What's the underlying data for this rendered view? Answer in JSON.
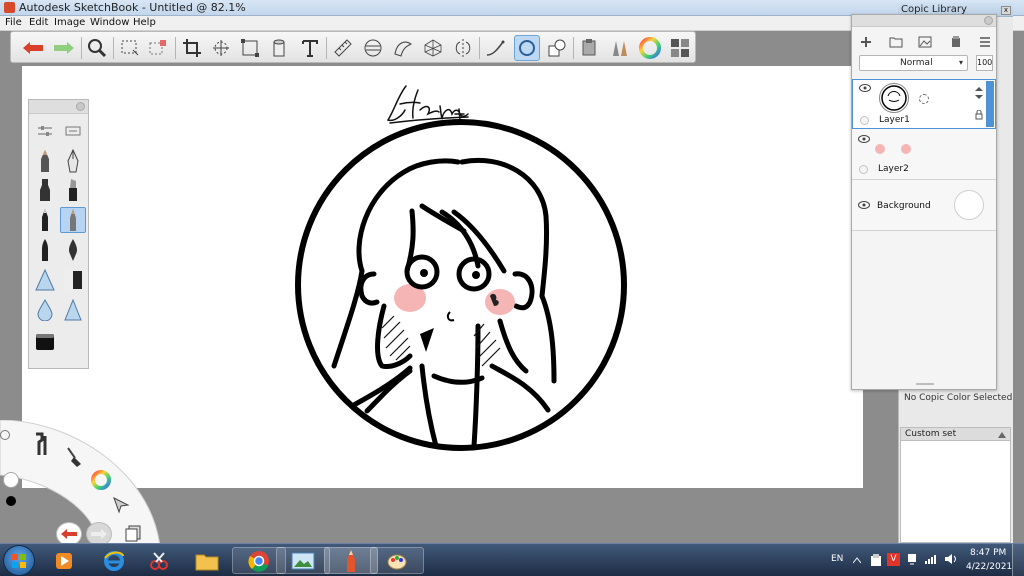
{
  "window": {
    "title": "Autodesk SketchBook - Untitled @ 82.1%"
  },
  "menu": [
    "File",
    "Edit",
    "Image",
    "Window",
    "Help"
  ],
  "toolbar": {
    "tools": [
      "undo-icon",
      "redo-icon",
      "zoom-icon",
      "select-icon",
      "crop-select-icon",
      "crop-icon",
      "move-icon",
      "transform-icon",
      "fill-icon",
      "text-icon",
      "ruler-icon",
      "ellipse-guide-icon",
      "french-curve-icon",
      "perspective-icon",
      "symmetry-icon",
      "line-icon",
      "ellipse-icon",
      "shape-icon",
      "copic-library-icon",
      "brush-library-icon",
      "color-wheel-icon",
      "palette-icon"
    ],
    "active_tool": "ellipse-icon"
  },
  "canvas": {
    "signature": "Ham",
    "blush_color": "#f5b5b5"
  },
  "copic_library": {
    "title": "Copic Library",
    "status": "No Copic Color Selected",
    "custom_set": "Custom set"
  },
  "layers": {
    "blend_mode": "Normal",
    "opacity": "100",
    "items": [
      {
        "name": "Layer1",
        "selected": true
      },
      {
        "name": "Layer2",
        "selected": false
      },
      {
        "name": "Background",
        "selected": false
      }
    ]
  },
  "taskbar": {
    "apps": [
      "windows-explorer",
      "media-player",
      "internet-explorer",
      "snipping-tool",
      "file-explorer",
      "chrome",
      "photo-viewer",
      "sketchbook",
      "paint"
    ],
    "language": "EN",
    "time": "8:47 PM",
    "date": "4/22/2021"
  },
  "colors": {
    "accent_blue": "#4f93d6",
    "blush": "#f5b5b5",
    "undo_red": "#d9402b",
    "redo_green": "#7ac36a"
  }
}
